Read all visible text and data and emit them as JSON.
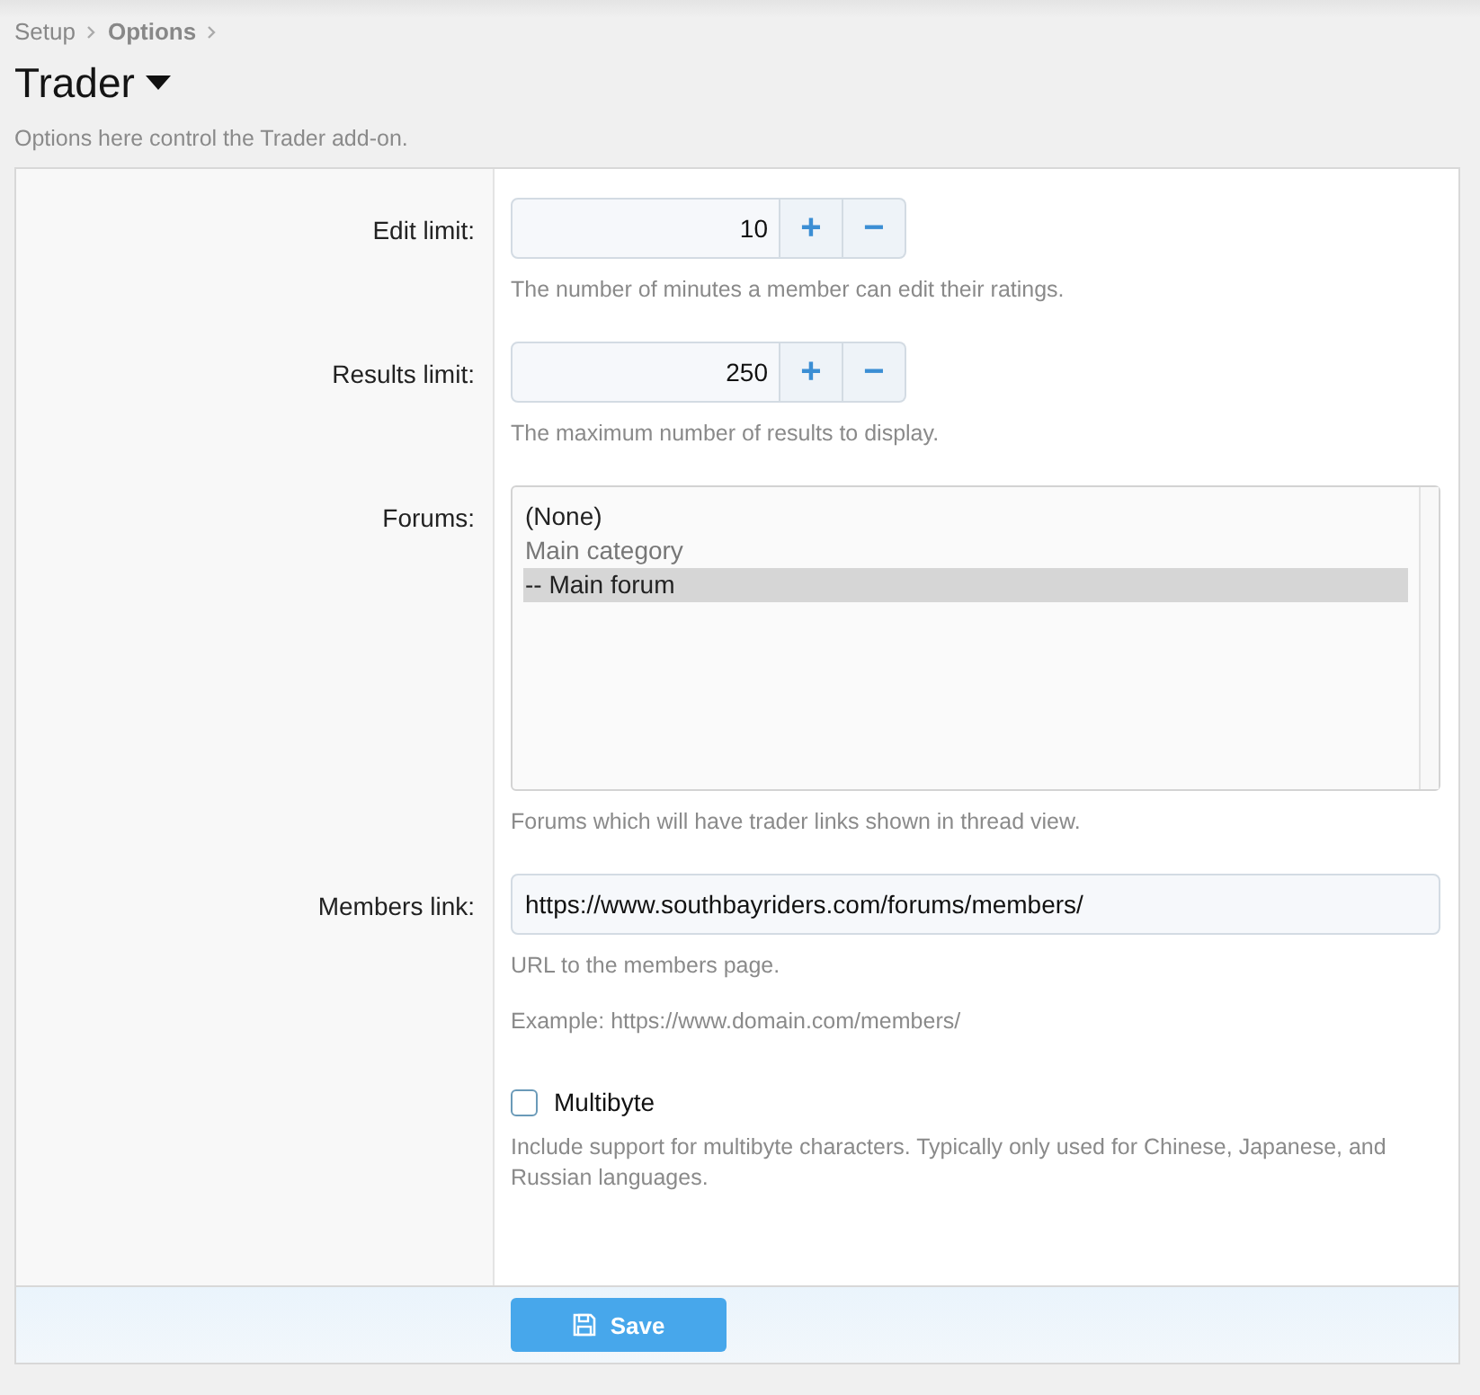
{
  "breadcrumb": [
    "Setup",
    "Options"
  ],
  "title": "Trader",
  "description": "Options here control the Trader add-on.",
  "rows": [
    {
      "kind": "spinner",
      "label": "Edit limit:",
      "value": "10",
      "plus": "+",
      "minus": "−",
      "hint": "The number of minutes a member can edit their ratings."
    },
    {
      "kind": "spinner",
      "label": "Results limit:",
      "value": "250",
      "plus": "+",
      "minus": "−",
      "hint": "The maximum number of results to display."
    },
    {
      "kind": "listbox",
      "label": "Forums:",
      "options": [
        {
          "text": "(None)",
          "kind": "option",
          "selected": false
        },
        {
          "text": "Main category",
          "kind": "category",
          "selected": false
        },
        {
          "text": "-- Main forum",
          "kind": "option",
          "selected": true
        }
      ],
      "hint": "Forums which will have trader links shown in thread view."
    },
    {
      "kind": "text",
      "label": "Members link:",
      "value": "https://www.southbayriders.com/forums/members/",
      "hint": "URL to the members page.",
      "example": "Example: https://www.domain.com/members/"
    },
    {
      "kind": "checkbox",
      "label": "Multibyte",
      "checked": false,
      "hint": "Include support for multibyte characters. Typically only used for Chinese, Japanese, and Russian languages."
    }
  ],
  "save": "Save"
}
